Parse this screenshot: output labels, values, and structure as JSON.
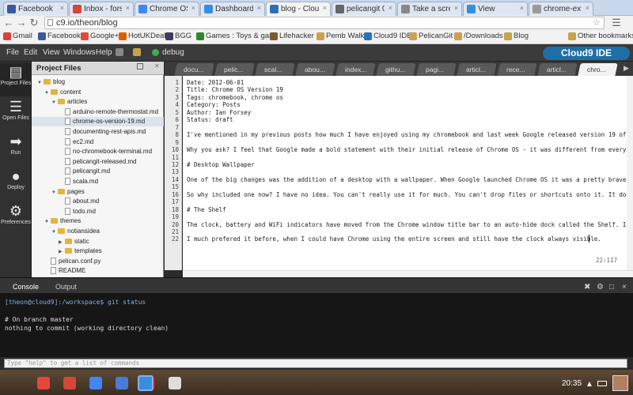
{
  "browser": {
    "tabs": [
      {
        "title": "Facebook",
        "color": "#3b5998"
      },
      {
        "title": "Inbox - forsey",
        "color": "#d44638"
      },
      {
        "title": "Chrome OS re",
        "color": "#4285f4"
      },
      {
        "title": "Dashboard - C",
        "color": "#3a8dde"
      },
      {
        "title": "blog - Cloud9",
        "color": "#2a72b5"
      },
      {
        "title": "pelicangit 0.1",
        "color": "#666666"
      },
      {
        "title": "Take a screen",
        "color": "#888888"
      },
      {
        "title": "View",
        "color": "#3a8dde"
      },
      {
        "title": "chrome-exter",
        "color": "#999999"
      }
    ],
    "url": "c9.io/theon/blog",
    "bookmarks": [
      {
        "label": "Gmail",
        "color": "#d44638"
      },
      {
        "label": "Facebook",
        "color": "#3b5998"
      },
      {
        "label": "Google+",
        "color": "#dd4b39"
      },
      {
        "label": "HotUKDeals",
        "color": "#e05a00"
      },
      {
        "label": "BGG",
        "color": "#3f3a60"
      },
      {
        "label": "Games : Toys & gam",
        "color": "#2a8a2a"
      },
      {
        "label": "Lifehacker",
        "color": "#7b5b2b"
      },
      {
        "label": "Pemb Walk",
        "color": "#c9a24a"
      },
      {
        "label": "Cloud9 IDE",
        "color": "#2a72b5"
      },
      {
        "label": "PelicanGit",
        "color": "#c9a24a"
      },
      {
        "label": "/Downloads",
        "color": "#c9a24a"
      },
      {
        "label": "Blog",
        "color": "#c9a24a"
      }
    ],
    "other_bookmarks": "Other bookmarks"
  },
  "menubar": {
    "items": [
      "File",
      "Edit",
      "View",
      "Windows",
      "Help"
    ],
    "debug": "debug",
    "logo": "Cloud9 IDE"
  },
  "rail": [
    {
      "label": "Project Files",
      "icon": "folder-icon"
    },
    {
      "label": "Open Files",
      "icon": "document-icon"
    },
    {
      "label": "Run",
      "icon": "run-icon"
    },
    {
      "label": "Deploy",
      "icon": "balloon-icon"
    },
    {
      "label": "Preferences",
      "icon": "gear-icon"
    }
  ],
  "project": {
    "header": "Project Files",
    "tree": [
      {
        "label": "blog",
        "type": "folder",
        "depth": 0,
        "open": true
      },
      {
        "label": "content",
        "type": "folder",
        "depth": 1,
        "open": true
      },
      {
        "label": "articles",
        "type": "folder",
        "depth": 2,
        "open": true
      },
      {
        "label": "arduino-remote-thermostat.md",
        "type": "file",
        "depth": 3
      },
      {
        "label": "chrome-os-version-19.md",
        "type": "file",
        "depth": 3,
        "selected": true
      },
      {
        "label": "documenting-rest-apis.md",
        "type": "file",
        "depth": 3
      },
      {
        "label": "ec2.md",
        "type": "file",
        "depth": 3
      },
      {
        "label": "no-chromebook-terminal.md",
        "type": "file",
        "depth": 3
      },
      {
        "label": "pelicangit-released.md",
        "type": "file",
        "depth": 3
      },
      {
        "label": "pelicangit.md",
        "type": "file",
        "depth": 3
      },
      {
        "label": "scala.md",
        "type": "file",
        "depth": 3
      },
      {
        "label": "pages",
        "type": "folder",
        "depth": 2,
        "open": true
      },
      {
        "label": "about.md",
        "type": "file",
        "depth": 3
      },
      {
        "label": "todo.md",
        "type": "file",
        "depth": 3
      },
      {
        "label": "themes",
        "type": "folder",
        "depth": 1,
        "open": true
      },
      {
        "label": "notiansidea",
        "type": "folder",
        "depth": 2,
        "open": true
      },
      {
        "label": "static",
        "type": "folder",
        "depth": 3,
        "open": false
      },
      {
        "label": "templates",
        "type": "folder",
        "depth": 3,
        "open": false
      },
      {
        "label": "pelican.conf.py",
        "type": "file",
        "depth": 1
      },
      {
        "label": "README",
        "type": "file",
        "depth": 1
      }
    ]
  },
  "editor_tabs": [
    "docu...",
    "pelic...",
    "scal...",
    "abou...",
    "index...",
    "githu...",
    "pagi...",
    "articl...",
    "rece...",
    "articl...",
    "chro..."
  ],
  "editor": {
    "lines": [
      "Date: 2012-06-01",
      "Title: Chrome OS Version 19",
      "Tags: chromebook, chrome os",
      "Category: Posts",
      "Author: Ian Forsey",
      "Status: draft",
      "",
      "I've mentioned in my previous posts how much I have enjoyed using my chromebook and last week Google released version 19 of Chrome OS",
      "",
      "Why you ask? I feel that Google made a bold statement with their initial release of Chrome OS - it was different from everything else",
      "",
      "# Desktop Wallpaper",
      "",
      "One of the big changes was the addition of a desktop with a wallpaper. When Google launched Chrome OS it was a pretty brave not to",
      "",
      "So why included one now? I have no idea. You can't really use it for much. You can't drop files or shortcuts onto it. It does have",
      "",
      "# The Shelf",
      "",
      "The clock, battery and WiFi indicators have moved from the Chrome window title bar to an auto-hide dock called the Shelf. I like",
      "",
      "I much prefered it before, when I could have Chrome using the entire screen and still have the clock always visible."
    ],
    "cursor_pos": "22:117"
  },
  "console": {
    "tabs": [
      "Console",
      "Output"
    ],
    "prompt": "[theon@cloud9]:/workspace$ git status",
    "output": [
      "# On branch master",
      "nothing to commit (working directory clean)"
    ],
    "input_placeholder": "Type \"help\" to get a list of commands"
  },
  "shelf": {
    "apps": [
      {
        "icon": "chrome-icon",
        "color": "#e8453c"
      },
      {
        "icon": "gmail-icon",
        "color": "#d44638"
      },
      {
        "icon": "search-icon",
        "color": "#4285f4"
      },
      {
        "icon": "docs-icon",
        "color": "#4a7bd6"
      },
      {
        "icon": "youtube-icon",
        "color": "#cc181e"
      },
      {
        "icon": "camera-icon",
        "color": "#4a4a4a"
      },
      {
        "icon": "screenshot-icon",
        "color": "#3a8dde"
      },
      {
        "icon": "apps-grid-icon",
        "color": "#dddddd"
      }
    ],
    "clock": "20:35"
  }
}
